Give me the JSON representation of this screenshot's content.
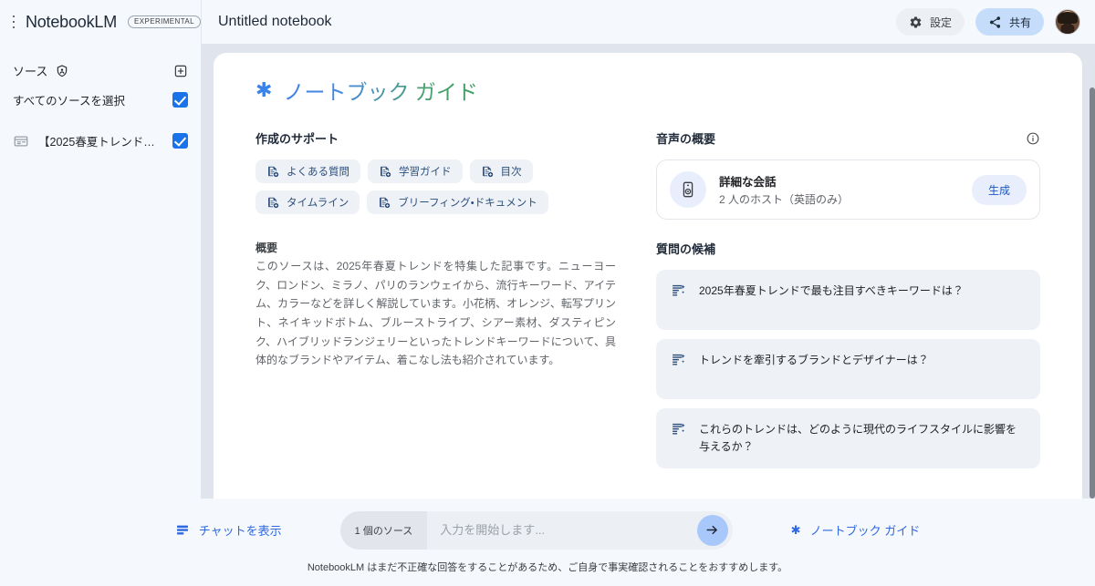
{
  "topbar": {
    "menu_icon": "hamburger-menu-icon",
    "brand": "NotebookLM",
    "experimental_badge": "EXPERIMENTAL",
    "notebook_title": "Untitled notebook",
    "settings_label": "設定",
    "settings_icon": "gear-icon",
    "share_label": "共有",
    "share_icon": "share-icon",
    "avatar_icon": "user-avatar"
  },
  "sidebar": {
    "sources_label": "ソース",
    "sources_icon": "shield-person-icon",
    "add_source_icon": "add-box-icon",
    "select_all_label": "すべてのソースを選択",
    "select_all_checked": true,
    "items": [
      {
        "icon": "web-article-icon",
        "label": "【2025春夏トレンド…",
        "checked": true
      }
    ]
  },
  "guide": {
    "spark_icon": "sparkle-icon",
    "title": "ノートブック ガイド",
    "creation_support": {
      "heading": "作成のサポート",
      "chips": [
        {
          "icon": "note-add-icon",
          "label": "よくある質問"
        },
        {
          "icon": "note-add-icon",
          "label": "学習ガイド"
        },
        {
          "icon": "note-add-icon",
          "label": "目次"
        },
        {
          "icon": "note-add-icon",
          "label": "タイムライン"
        },
        {
          "icon": "note-add-icon",
          "label": "ブリーフィング・ドキュメント"
        }
      ]
    },
    "summary": {
      "heading": "概要",
      "body": "このソースは、2025年春夏トレンドを特集した記事です。ニューヨーク、ロンドン、ミラノ、パリのランウェイから、流行キーワード、アイテム、カラーなどを詳しく解説しています。小花柄、オレンジ、転写プリント、ネイキッドボトム、ブルーストライプ、シアー素材、ダスティピンク、ハイブリッドランジェリーといったトレンドキーワードについて、具体的なブランドやアイテム、着こなし法も紹介されています。"
    },
    "audio_overview": {
      "heading": "音声の概要",
      "info_icon": "info-icon",
      "card_icon": "audio-speaker-icon",
      "card_title": "詳細な会話",
      "card_subtitle": "2 人のホスト（英語のみ）",
      "generate_label": "生成"
    },
    "suggested_questions": {
      "heading": "質問の候補",
      "item_icon": "question-suggestion-icon",
      "items": [
        "2025年春夏トレンドで最も注目すべきキーワードは？",
        "トレンドを牽引するブランドとデザイナーは？",
        "これらのトレンドは、どのように現代のライフスタイルに影響を与えるか？"
      ]
    }
  },
  "bottombar": {
    "show_chat_icon": "chat-panel-icon",
    "show_chat_label": "チャットを表示",
    "source_count_label": "1 個のソース",
    "input_value": "",
    "input_placeholder": "入力を開始します...",
    "send_icon": "arrow-right-icon",
    "guide_icon": "sparkle-icon",
    "guide_label": "ノートブック ガイド",
    "disclaimer": "NotebookLM はまだ不正確な回答をすることがあるため、ご自身で事実確認されることをおすすめします。"
  },
  "colors": {
    "accent_blue": "#1a73e8",
    "page_bg": "#dfe4ed",
    "chrome_bg": "#f5f8fc",
    "chip_bg": "#eef1f6",
    "share_pill": "#c5ddfa"
  }
}
